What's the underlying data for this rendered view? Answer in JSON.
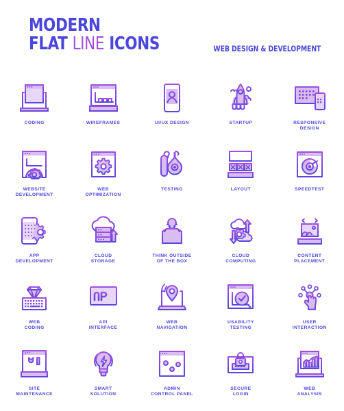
{
  "header": {
    "title_line1": "MODERN",
    "title_word_flat": "FLAT",
    "title_word_line": "LINE",
    "title_word_icons": "ICONS",
    "subtitle": "WEB DESIGN & DEVELOPMENT"
  },
  "colors": {
    "brand_blue": "#4b46dd",
    "brand_purple": "#a04fd8",
    "stroke_top": "#9d4fe0",
    "stroke_bottom": "#5b46dd",
    "fill_light": "#d9bdf0",
    "fill_lighter": "#e8d6f7",
    "background": "#ffffff"
  },
  "icons": [
    {
      "id": "coding",
      "label": "CODING",
      "icon_name": "laptop-code-icon"
    },
    {
      "id": "wireframes",
      "label": "WIREFRAMES",
      "icon_name": "wireframe-browser-ruler-icon"
    },
    {
      "id": "ui-ux-design",
      "label": "UI/UX DESIGN",
      "icon_name": "phone-user-profile-icon"
    },
    {
      "id": "startup",
      "label": "STARTUP",
      "icon_name": "rocket-launch-icon"
    },
    {
      "id": "responsive-design",
      "label": "RESPONSIVE\nDESIGN",
      "icon_name": "monitor-phone-icon"
    },
    {
      "id": "website-development",
      "label": "WEBSITE\nDEVELOPMENT",
      "icon_name": "browser-gear-icon"
    },
    {
      "id": "web-optimization",
      "label": "WEB\nOPTIMIZATION",
      "icon_name": "browser-cog-icon"
    },
    {
      "id": "testing",
      "label": "TESTING",
      "icon_name": "test-tube-flask-icon"
    },
    {
      "id": "layout",
      "label": "LAYOUT",
      "icon_name": "layout-grid-icon"
    },
    {
      "id": "speedtest",
      "label": "SPEEDTEST",
      "icon_name": "browser-speedometer-icon"
    },
    {
      "id": "app-development",
      "label": "APP\nDEVELOPMENT",
      "icon_name": "phone-gear-icon"
    },
    {
      "id": "cloud-storage",
      "label": "CLOUD\nSTORAGE",
      "icon_name": "cloud-server-upload-icon"
    },
    {
      "id": "think-outside-box",
      "label": "THINK OUTSIDE\nOF THE BOX",
      "icon_name": "box-lightbulb-icon"
    },
    {
      "id": "cloud-computing",
      "label": "CLOUD\nCOMPUTING",
      "icon_name": "cloud-gear-arrows-icon"
    },
    {
      "id": "content-placement",
      "label": "CONTENT\nPLACEMENT",
      "icon_name": "image-measure-ruler-icon"
    },
    {
      "id": "web-coding",
      "label": "WEB\nCODING",
      "icon_name": "diamond-keyboard-icon"
    },
    {
      "id": "api-interface",
      "label": "API\nINTERFACE",
      "icon_name": "monitor-api-icon"
    },
    {
      "id": "web-navigation",
      "label": "WEB\nNAVIGATION",
      "icon_name": "laptop-location-pin-icon"
    },
    {
      "id": "usability-testing",
      "label": "USABILITY\nTESTING",
      "icon_name": "browser-magnifier-check-icon"
    },
    {
      "id": "user-interaction",
      "label": "USER\nINTERACTION",
      "icon_name": "hand-touch-network-icon"
    },
    {
      "id": "site-maintenance",
      "label": "SITE\nMAINTENANCE",
      "icon_name": "browser-tools-icon"
    },
    {
      "id": "smart-solution",
      "label": "SMART\nSOLUTION",
      "icon_name": "lightbulb-bolt-icon"
    },
    {
      "id": "admin-control-panel",
      "label": "ADMIN\nCONTROL PANEL",
      "icon_name": "browser-sliders-icon"
    },
    {
      "id": "secure-login",
      "label": "SECURE\nLOGIN",
      "icon_name": "monitor-padlock-icon"
    },
    {
      "id": "web-analysis",
      "label": "WEB\nANALYSIS",
      "icon_name": "laptop-bar-chart-icon"
    }
  ]
}
